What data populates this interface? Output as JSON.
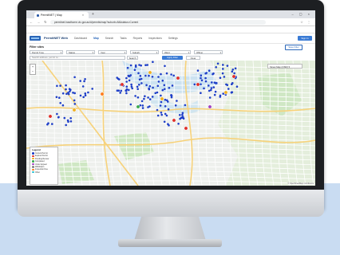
{
  "browser": {
    "tab_title": "PermitNET | Map",
    "tab_close": "×",
    "new_tab": "+",
    "window_controls": "– ▢ ×",
    "nav_icons": "← → ↻",
    "address": "permitnet.hawthorne.vic.gov.au/#/permits/map?suburb=All&status=Current",
    "right_icons": "☆ ⋮",
    "bookmarks": [
      {
        "label": "Apps",
        "color": "#4a7fd4"
      },
      {
        "label": "Technology | Governm...",
        "color": "#d45a3c"
      },
      {
        "label": "PEN Environment",
        "color": "#3c9a4e"
      },
      {
        "label": "https://gisadmin.ha...",
        "color": "#4a7fd4"
      },
      {
        "label": "Daily Tasks",
        "color": "#f0a030"
      },
      {
        "label": "Mobile Map",
        "color": "#6b4ad4"
      },
      {
        "label": "Enforcement Schedule",
        "color": "#4a7fd4"
      },
      {
        "label": "SUBMIT Conditions",
        "color": "#d43c6b"
      },
      {
        "label": "Tax Bills",
        "color": "#3c9a4e"
      },
      {
        "label": "Duty Inspector | ...",
        "color": "#4a7fd4"
      },
      {
        "label": "NEAT Rec Open Data",
        "color": "#d45a3c"
      },
      {
        "label": "Land Info Officers",
        "color": "#4a7fd4"
      },
      {
        "label": "Permit Lookup Search",
        "color": "#2a66b8"
      },
      {
        "label": "Other",
        "color": "#f0a030"
      }
    ]
  },
  "app": {
    "title": "PermitNET Web",
    "nav": [
      "Dashboard",
      "Map",
      "Search",
      "Tasks",
      "Reports",
      "Inspections",
      "Settings"
    ],
    "nav_active_index": 1,
    "login_label": "Sign In"
  },
  "filter": {
    "title": "Filter sites",
    "save_label": "Save Filter",
    "selects": [
      "Permit Type",
      "Status",
      "Year",
      "Suburb",
      "Ward",
      "Officer"
    ],
    "chevron": "▾",
    "apply_label": "Apply Filter",
    "clear_label": "Clear",
    "search_placeholder": "Search address, permit no...",
    "search_button": "Search"
  },
  "map": {
    "zoom_in": "+",
    "zoom_out": "−",
    "layer_label": "Street Map (OSM) ▾",
    "legend_title": "Legend",
    "legend": [
      {
        "label": "Current Permit",
        "color": "#1f3fc8"
      },
      {
        "label": "Expired Permit",
        "color": "#e0302a"
      },
      {
        "label": "Pending Review",
        "color": "#f0b020"
      },
      {
        "label": "Completed",
        "color": "#3cab4e"
      },
      {
        "label": "Under Appeal",
        "color": "#a040c0"
      },
      {
        "label": "Withdrawn",
        "color": "#888888"
      },
      {
        "label": "Inspection Due",
        "color": "#ff7a1a"
      },
      {
        "label": "Other",
        "color": "#2ac0d0"
      }
    ],
    "attribution": "© OpenStreetMap contributors",
    "colors": {
      "water": "#c5dff0",
      "park": "#cfe7c4",
      "road_major": "#f7d27a",
      "road": "#ffffff",
      "land": "#eef0ed"
    }
  }
}
